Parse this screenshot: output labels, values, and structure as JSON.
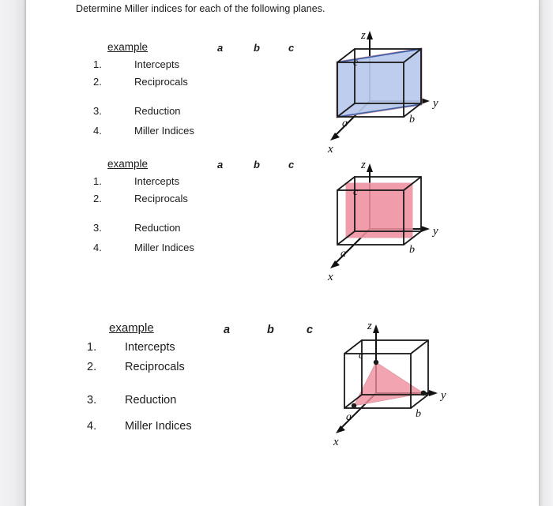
{
  "page": {
    "prompt": "Determine Miller indices for each of the following planes."
  },
  "columns": {
    "a": "a",
    "b": "b",
    "c": "c"
  },
  "steps": {
    "n1": "1.",
    "n2": "2.",
    "n3": "3.",
    "n4": "4.",
    "s1": "Intercepts",
    "s2": "Reciprocals",
    "s3": "Reduction",
    "s4": "Miller Indices"
  },
  "blocks": [
    {
      "title": "example"
    },
    {
      "title": "example"
    },
    {
      "title": "example"
    }
  ],
  "axes": {
    "x": "x",
    "y": "y",
    "z": "z",
    "a": "a",
    "b": "b",
    "c": "c"
  },
  "colors": {
    "plane_blue_fill": "#b9c9ec",
    "plane_blue_edge": "#3b5fa8",
    "plane_blue_outline": "#c08898",
    "plane_pink_fill": "#ef8e9e",
    "plane_pink_edge": "#d4636f",
    "cube_edge": "#1a1a1a",
    "axis": "#111111",
    "text": "#1c1c1c",
    "page_bg": "#ffffff",
    "edge_gray": "#e9e9ec"
  },
  "figures": [
    {
      "name": "cube-plane-1",
      "plane_type": "parallelogram",
      "plane_color": "plane_blue_fill",
      "description": "plane cutting through cube, shaded light blue"
    },
    {
      "name": "cube-plane-2",
      "plane_type": "rectangle-midplane",
      "plane_color": "plane_pink_fill",
      "description": "mid-plane rectangle shaded pink"
    },
    {
      "name": "cube-plane-3",
      "plane_type": "triangle",
      "plane_color": "plane_pink_fill",
      "description": "triangular plane with three intercept dots shaded pink"
    }
  ]
}
